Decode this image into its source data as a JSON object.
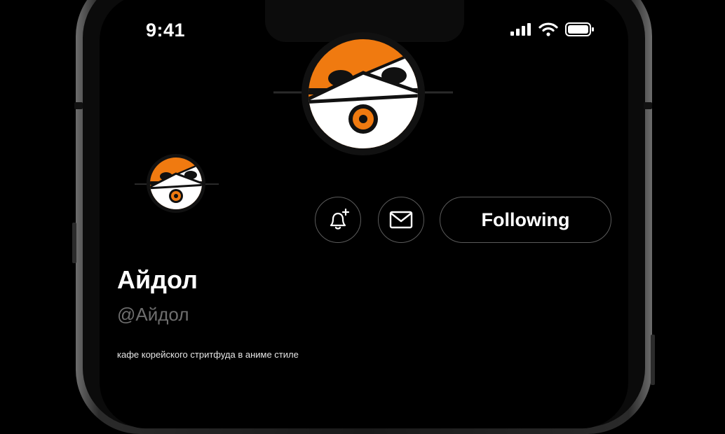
{
  "status_bar": {
    "time": "9:41",
    "icons": [
      "cellular-signal-icon",
      "wifi-icon",
      "battery-icon"
    ]
  },
  "profile": {
    "display_name": "Айдол",
    "handle": "@Айдол",
    "bio": "кафе корейского стритфуда в аниме стиле"
  },
  "actions": {
    "notify_icon": "bell-plus-icon",
    "message_icon": "mail-icon",
    "follow_label": "Following"
  },
  "theme": {
    "background": "#000000",
    "brand_orange": "#F07A10",
    "text_primary": "#FFFFFF",
    "text_secondary": "#6E6E6E",
    "button_border": "#5B5B5B"
  }
}
